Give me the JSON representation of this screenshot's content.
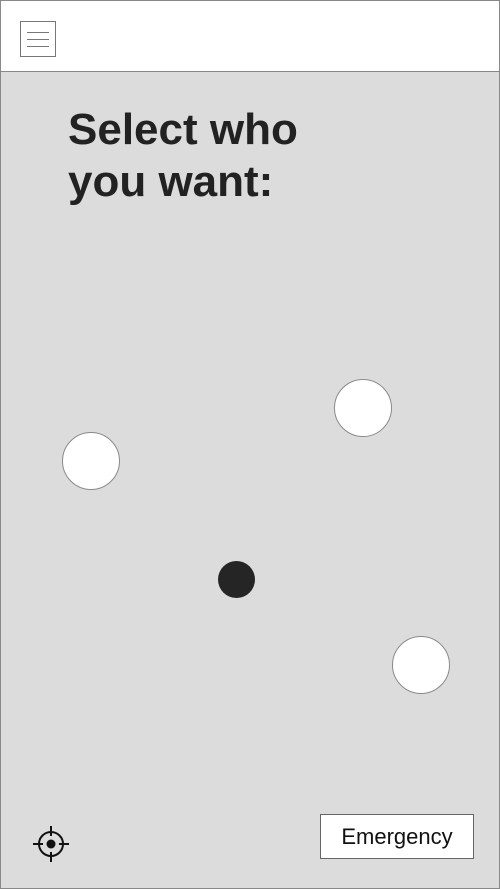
{
  "header": {
    "menu_icon": "hamburger-menu-icon"
  },
  "main": {
    "title_line1": "Select who",
    "title_line2": "you want:",
    "people_count_visible": 3
  },
  "footer": {
    "locate_icon": "crosshair-icon",
    "emergency_label": "Emergency"
  },
  "colors": {
    "map_background": "#dcdcdc",
    "header_background": "#ffffff",
    "person_marker": "#ffffff",
    "current_location_marker": "#252525",
    "title_text": "#222222"
  }
}
